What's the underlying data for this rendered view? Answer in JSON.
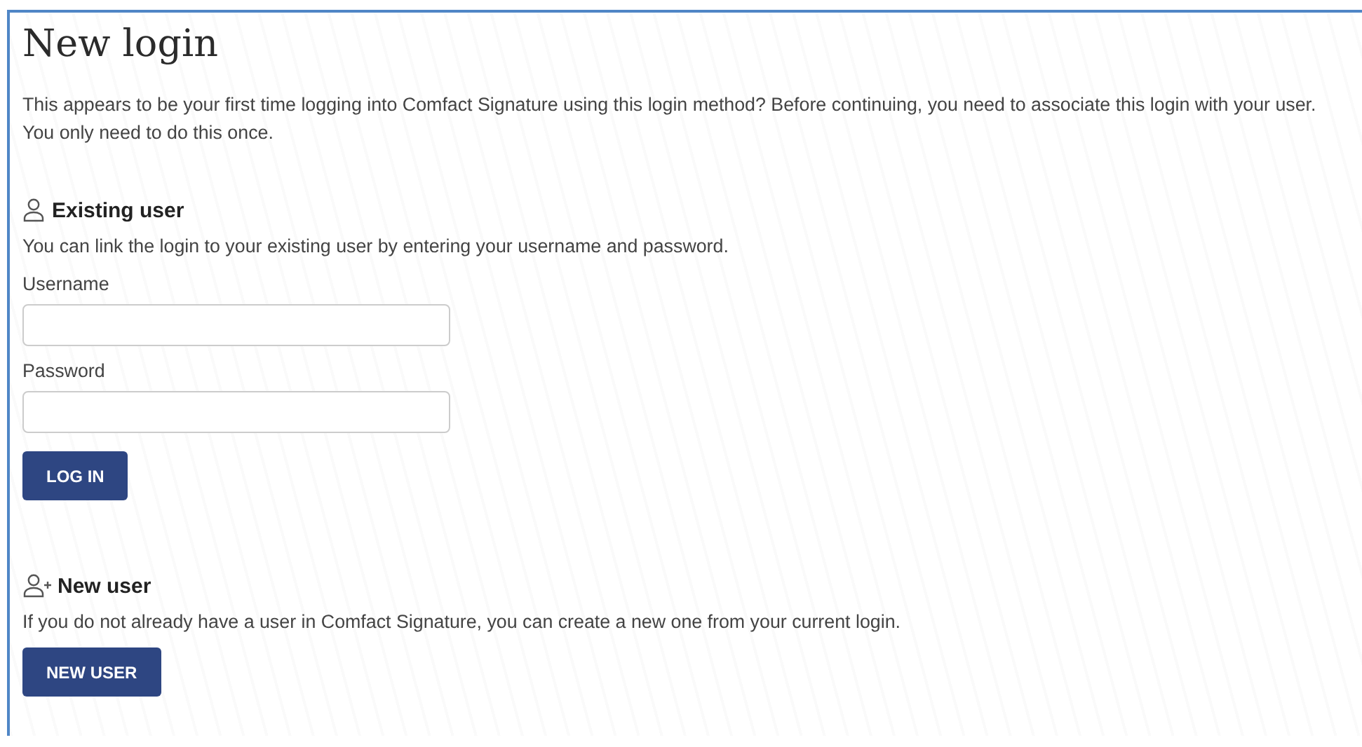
{
  "title": "New login",
  "intro": "This appears to be your first time logging into Comfact Signature using this login method? Before continuing, you need to associate this login with your user. You only need to do this once.",
  "sections": [
    {
      "kind": "login",
      "heading": "Existing user",
      "description": "You can link the login to your existing user by entering your username and password.",
      "fields": [
        {
          "label": "Username"
        },
        {
          "label": "Password"
        }
      ],
      "button": "LOG IN"
    },
    {
      "kind": "create",
      "heading": "New user",
      "description": "If you do not already have a user in Comfact Signature, you can create a new one from your current login.",
      "button": "NEW USER"
    }
  ]
}
